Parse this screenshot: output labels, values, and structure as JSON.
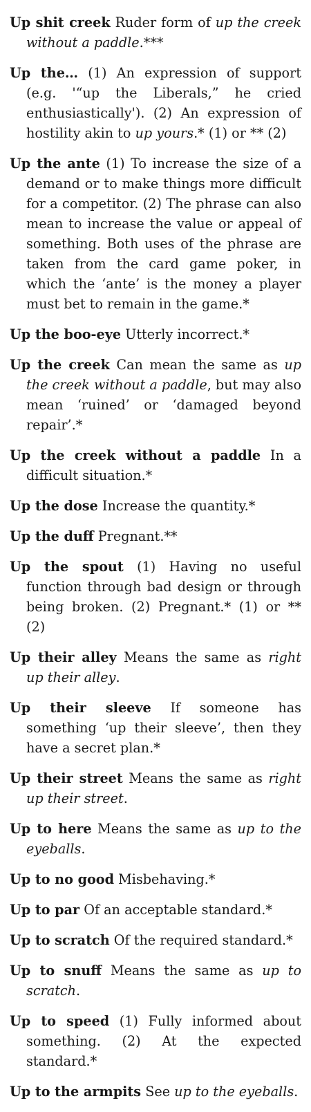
{
  "entries": [
    {
      "term": "Up shit creek",
      "segments": [
        {
          "t": " Ruder form of "
        },
        {
          "t": "up the creek without a paddle",
          "i": true
        },
        {
          "t": ".***"
        }
      ]
    },
    {
      "term": "Up the…",
      "segments": [
        {
          "t": " (1) An expression of support (e.g. '“up the Liberals,” he cried enthusiastically'). (2) An expression of hostility akin to "
        },
        {
          "t": "up yours",
          "i": true
        },
        {
          "t": ".* (1) or ** (2)"
        }
      ]
    },
    {
      "term": "Up the ante",
      "segments": [
        {
          "t": " (1) To increase the size of a demand or to make things more difficult for a competitor. (2) The phrase can also mean to increase the value or appeal of something. Both uses of the phrase are taken from the card game poker, in which the ‘ante’ is the money a player must bet to remain in the game.*"
        }
      ]
    },
    {
      "term": "Up the boo-eye",
      "segments": [
        {
          "t": " Utterly incorrect.*"
        }
      ]
    },
    {
      "term": "Up the creek",
      "segments": [
        {
          "t": " Can mean the same as "
        },
        {
          "t": "up the creek without a paddle",
          "i": true
        },
        {
          "t": ", but may also mean ‘ruined’ or ‘damaged beyond repair’.*"
        }
      ]
    },
    {
      "term": "Up the creek without a paddle",
      "segments": [
        {
          "t": " In a difficult situation.*"
        }
      ]
    },
    {
      "term": "Up the dose",
      "segments": [
        {
          "t": " Increase the quantity.*"
        }
      ]
    },
    {
      "term": "Up the duff",
      "segments": [
        {
          "t": " Pregnant.**"
        }
      ]
    },
    {
      "term": "Up the spout",
      "segments": [
        {
          "t": " (1) Having no useful function through bad design or through being broken. (2) Pregnant.* (1) or ** (2)"
        }
      ]
    },
    {
      "term": "Up their alley",
      "segments": [
        {
          "t": " Means the same as "
        },
        {
          "t": "right up their alley",
          "i": true
        },
        {
          "t": "."
        }
      ]
    },
    {
      "term": "Up their sleeve",
      "segments": [
        {
          "t": " If someone has something ‘up their sleeve’, then they have a secret plan.*"
        }
      ]
    },
    {
      "term": "Up their street",
      "segments": [
        {
          "t": " Means the same as "
        },
        {
          "t": "right up their street",
          "i": true
        },
        {
          "t": "."
        }
      ]
    },
    {
      "term": "Up to here",
      "segments": [
        {
          "t": " Means the same as "
        },
        {
          "t": "up to the eyeballs",
          "i": true
        },
        {
          "t": "."
        }
      ]
    },
    {
      "term": "Up to no good",
      "segments": [
        {
          "t": " Misbehaving.*"
        }
      ]
    },
    {
      "term": "Up to par",
      "segments": [
        {
          "t": " Of an acceptable standard.*"
        }
      ]
    },
    {
      "term": "Up to scratch",
      "segments": [
        {
          "t": " Of the required standard.*"
        }
      ]
    },
    {
      "term": "Up to snuff",
      "segments": [
        {
          "t": " Means the same as "
        },
        {
          "t": "up to scratch",
          "i": true
        },
        {
          "t": "."
        }
      ]
    },
    {
      "term": "Up to speed",
      "segments": [
        {
          "t": " (1) Fully informed about something. (2) At the expected standard.*"
        }
      ]
    },
    {
      "term": "Up to the armpits",
      "segments": [
        {
          "t": " See "
        },
        {
          "t": "up to the eyeballs",
          "i": true
        },
        {
          "t": "."
        }
      ]
    }
  ]
}
